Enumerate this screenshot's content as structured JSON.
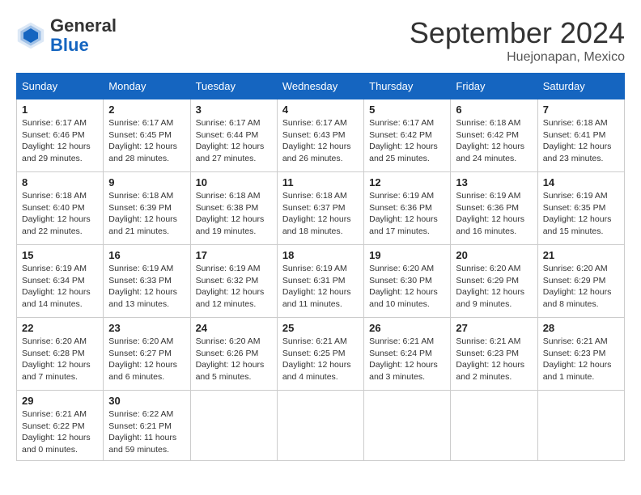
{
  "header": {
    "logo_general": "General",
    "logo_blue": "Blue",
    "month_title": "September 2024",
    "location": "Huejonapan, Mexico"
  },
  "days_of_week": [
    "Sunday",
    "Monday",
    "Tuesday",
    "Wednesday",
    "Thursday",
    "Friday",
    "Saturday"
  ],
  "weeks": [
    [
      {
        "day": "1",
        "sunrise": "6:17 AM",
        "sunset": "6:46 PM",
        "daylight": "12 hours and 29 minutes."
      },
      {
        "day": "2",
        "sunrise": "6:17 AM",
        "sunset": "6:45 PM",
        "daylight": "12 hours and 28 minutes."
      },
      {
        "day": "3",
        "sunrise": "6:17 AM",
        "sunset": "6:44 PM",
        "daylight": "12 hours and 27 minutes."
      },
      {
        "day": "4",
        "sunrise": "6:17 AM",
        "sunset": "6:43 PM",
        "daylight": "12 hours and 26 minutes."
      },
      {
        "day": "5",
        "sunrise": "6:17 AM",
        "sunset": "6:42 PM",
        "daylight": "12 hours and 25 minutes."
      },
      {
        "day": "6",
        "sunrise": "6:18 AM",
        "sunset": "6:42 PM",
        "daylight": "12 hours and 24 minutes."
      },
      {
        "day": "7",
        "sunrise": "6:18 AM",
        "sunset": "6:41 PM",
        "daylight": "12 hours and 23 minutes."
      }
    ],
    [
      {
        "day": "8",
        "sunrise": "6:18 AM",
        "sunset": "6:40 PM",
        "daylight": "12 hours and 22 minutes."
      },
      {
        "day": "9",
        "sunrise": "6:18 AM",
        "sunset": "6:39 PM",
        "daylight": "12 hours and 21 minutes."
      },
      {
        "day": "10",
        "sunrise": "6:18 AM",
        "sunset": "6:38 PM",
        "daylight": "12 hours and 19 minutes."
      },
      {
        "day": "11",
        "sunrise": "6:18 AM",
        "sunset": "6:37 PM",
        "daylight": "12 hours and 18 minutes."
      },
      {
        "day": "12",
        "sunrise": "6:19 AM",
        "sunset": "6:36 PM",
        "daylight": "12 hours and 17 minutes."
      },
      {
        "day": "13",
        "sunrise": "6:19 AM",
        "sunset": "6:36 PM",
        "daylight": "12 hours and 16 minutes."
      },
      {
        "day": "14",
        "sunrise": "6:19 AM",
        "sunset": "6:35 PM",
        "daylight": "12 hours and 15 minutes."
      }
    ],
    [
      {
        "day": "15",
        "sunrise": "6:19 AM",
        "sunset": "6:34 PM",
        "daylight": "12 hours and 14 minutes."
      },
      {
        "day": "16",
        "sunrise": "6:19 AM",
        "sunset": "6:33 PM",
        "daylight": "12 hours and 13 minutes."
      },
      {
        "day": "17",
        "sunrise": "6:19 AM",
        "sunset": "6:32 PM",
        "daylight": "12 hours and 12 minutes."
      },
      {
        "day": "18",
        "sunrise": "6:19 AM",
        "sunset": "6:31 PM",
        "daylight": "12 hours and 11 minutes."
      },
      {
        "day": "19",
        "sunrise": "6:20 AM",
        "sunset": "6:30 PM",
        "daylight": "12 hours and 10 minutes."
      },
      {
        "day": "20",
        "sunrise": "6:20 AM",
        "sunset": "6:29 PM",
        "daylight": "12 hours and 9 minutes."
      },
      {
        "day": "21",
        "sunrise": "6:20 AM",
        "sunset": "6:29 PM",
        "daylight": "12 hours and 8 minutes."
      }
    ],
    [
      {
        "day": "22",
        "sunrise": "6:20 AM",
        "sunset": "6:28 PM",
        "daylight": "12 hours and 7 minutes."
      },
      {
        "day": "23",
        "sunrise": "6:20 AM",
        "sunset": "6:27 PM",
        "daylight": "12 hours and 6 minutes."
      },
      {
        "day": "24",
        "sunrise": "6:20 AM",
        "sunset": "6:26 PM",
        "daylight": "12 hours and 5 minutes."
      },
      {
        "day": "25",
        "sunrise": "6:21 AM",
        "sunset": "6:25 PM",
        "daylight": "12 hours and 4 minutes."
      },
      {
        "day": "26",
        "sunrise": "6:21 AM",
        "sunset": "6:24 PM",
        "daylight": "12 hours and 3 minutes."
      },
      {
        "day": "27",
        "sunrise": "6:21 AM",
        "sunset": "6:23 PM",
        "daylight": "12 hours and 2 minutes."
      },
      {
        "day": "28",
        "sunrise": "6:21 AM",
        "sunset": "6:23 PM",
        "daylight": "12 hours and 1 minute."
      }
    ],
    [
      {
        "day": "29",
        "sunrise": "6:21 AM",
        "sunset": "6:22 PM",
        "daylight": "12 hours and 0 minutes."
      },
      {
        "day": "30",
        "sunrise": "6:22 AM",
        "sunset": "6:21 PM",
        "daylight": "11 hours and 59 minutes."
      },
      null,
      null,
      null,
      null,
      null
    ]
  ]
}
